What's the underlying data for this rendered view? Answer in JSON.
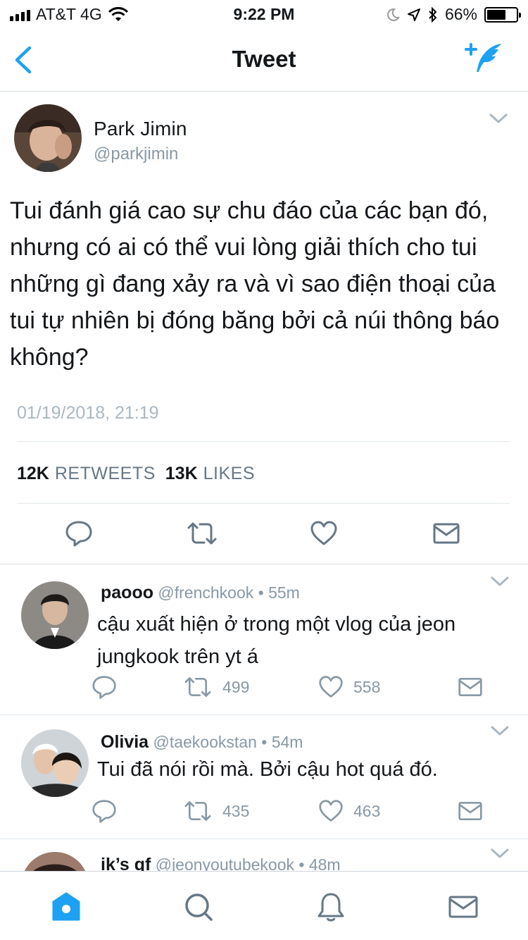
{
  "status_bar": {
    "carrier": "AT&T 4G",
    "time": "9:22 PM",
    "battery": "66%",
    "battery_level": 0.66
  },
  "nav": {
    "title": "Tweet",
    "accent": "#1da1f2"
  },
  "tweet": {
    "author_name": "Park Jimin",
    "author_handle": "@parkjimin",
    "text": "Tui đánh giá cao sự chu đáo của các bạn đó, nhưng có ai có thể vui lòng giải thích cho tui những gì đang xảy ra và vì sao điện thoại của tui tự nhiên bị đóng băng bởi cả núi thông báo không?",
    "timestamp": "01/19/2018, 21:19",
    "retweets_count": "12K",
    "retweets_label": "RETWEETS",
    "likes_count": "13K",
    "likes_label": "LIKES"
  },
  "replies": [
    {
      "name": "paooo",
      "handle": "@frenchkook",
      "time": "• 55m",
      "text": "cậu xuất hiện ở trong một vlog của jeon jungkook trên yt á",
      "retweets": "499",
      "likes": "558"
    },
    {
      "name": "Olivia",
      "handle": "@taekookstan",
      "time": "• 54m",
      "text": "Tui đã nói rồi mà. Bởi cậu hot quá đó.",
      "retweets": "435",
      "likes": "463"
    },
    {
      "name": "ik’s gf",
      "handle": "@jeonyoutubekook",
      "time": "• 48m"
    }
  ],
  "icons": {
    "back": "chevron-left-icon",
    "compose": "compose-tweet-icon",
    "reply": "reply-icon",
    "retweet": "retweet-icon",
    "like": "heart-icon",
    "message": "envelope-icon",
    "home": "home-icon",
    "search": "search-icon",
    "notifications": "bell-icon",
    "messages": "envelope-icon"
  }
}
